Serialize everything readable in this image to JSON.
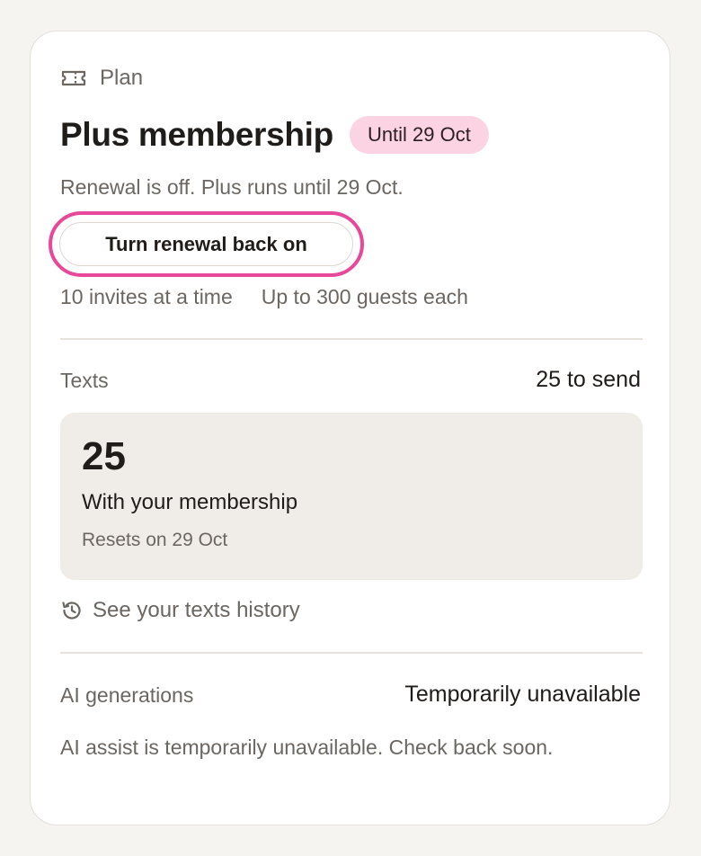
{
  "plan": {
    "section_label": "Plan",
    "icon": "ticket-icon",
    "title": "Plus membership",
    "badge": "Until 29 Oct",
    "renewal_note": "Renewal is off. Plus runs until 29 Oct.",
    "renew_button_label": "Turn renewal back on",
    "limits": {
      "invites": "10 invites at a time",
      "guests": "Up to 300 guests each"
    }
  },
  "texts": {
    "label": "Texts",
    "summary": "25 to send",
    "count": "25",
    "source": "With your membership",
    "reset": "Resets on 29 Oct",
    "history_icon": "history-icon",
    "history_link": "See your texts history"
  },
  "ai": {
    "label": "AI generations",
    "status": "Temporarily unavailable",
    "note": "AI assist is temporarily unavailable. Check back soon."
  },
  "colors": {
    "accent_ring": "#e8489a",
    "badge_bg": "#fbd3e2",
    "muted_text": "#6b6661",
    "panel_bg": "#f0ede9"
  }
}
